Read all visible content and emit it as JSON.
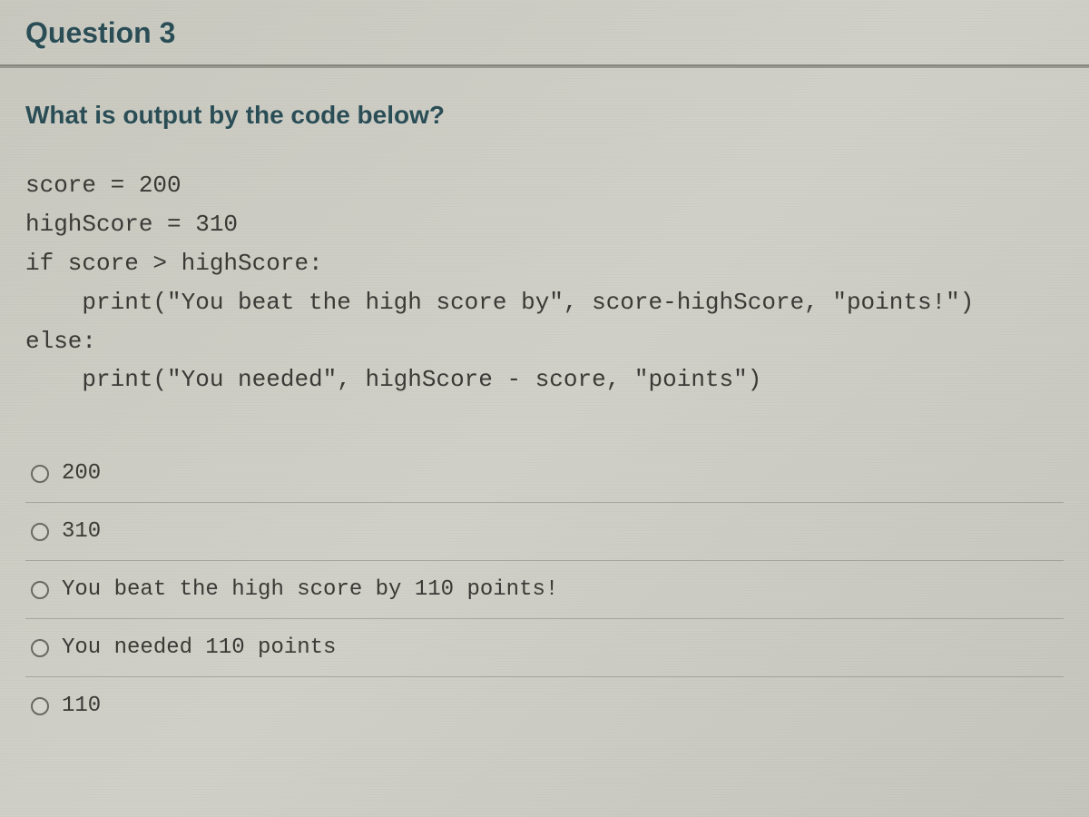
{
  "header": {
    "title": "Question 3"
  },
  "prompt": "What is output by the code below?",
  "code": "score = 200\nhighScore = 310\nif score > highScore:\n    print(\"You beat the high score by\", score-highScore, \"points!\")\nelse:\n    print(\"You needed\", highScore - score, \"points\")",
  "options": [
    {
      "label": "200"
    },
    {
      "label": "310"
    },
    {
      "label": "You beat the high score by 110 points!"
    },
    {
      "label": "You needed 110 points"
    },
    {
      "label": "110"
    }
  ]
}
